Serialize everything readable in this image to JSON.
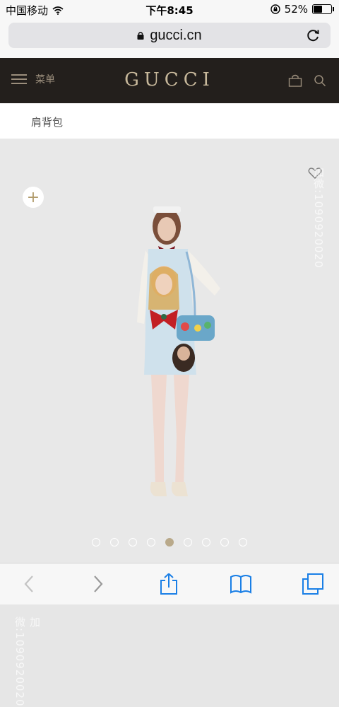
{
  "status_bar": {
    "carrier": "中国移动",
    "time": "下午8:45",
    "battery_percent": "52%",
    "battery_level": 0.52,
    "signal_icon": "signal-dots-icon",
    "wifi_icon": "wifi-icon",
    "rotation_lock_icon": "rotation-lock-icon"
  },
  "browser": {
    "url": "gucci.cn",
    "lock_icon": "lock-icon",
    "reload_icon": "reload-icon"
  },
  "header": {
    "menu_label": "菜单",
    "logo": "GUCCI",
    "bag_icon": "shopping-bag-icon",
    "search_icon": "search-icon",
    "background": "#231f1c",
    "accent": "#c7b89b"
  },
  "breadcrumb": {
    "label": "肩背包"
  },
  "product": {
    "wishlist_icon": "heart-icon",
    "zoom_label": "+",
    "carousel": {
      "total": 9,
      "active_index": 4
    }
  },
  "watermark": {
    "right_text": "加微:1090920020",
    "left_text": "加微:1090920020"
  },
  "toolbar": {
    "icons": [
      "back-icon",
      "forward-icon",
      "share-icon",
      "bookmarks-icon",
      "tabs-icon"
    ]
  }
}
